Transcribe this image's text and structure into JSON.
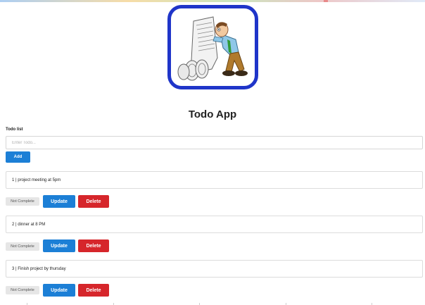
{
  "app": {
    "title": "Todo App"
  },
  "todo_form": {
    "list_label": "Todo list",
    "input_placeholder": "Enter Todo...",
    "input_value": "",
    "add_label": "Add"
  },
  "todos": [
    {
      "text": "1 | project meeting at 5pm",
      "status_label": "Not Complete",
      "update_label": "Update",
      "delete_label": "Delete"
    },
    {
      "text": "2 | dinner at 8 PM",
      "status_label": "Not Complete",
      "update_label": "Update",
      "delete_label": "Delete"
    },
    {
      "text": "3 | Finish project by thursday",
      "status_label": "Not Complete",
      "update_label": "Update",
      "delete_label": "Delete"
    }
  ],
  "colors": {
    "primary": "#1c7fd6",
    "danger": "#d6262b",
    "logo_border": "#1f35c9",
    "status_bg": "#e6e6e6"
  },
  "icons": {
    "logo": "man-reading-long-list-illustration"
  }
}
